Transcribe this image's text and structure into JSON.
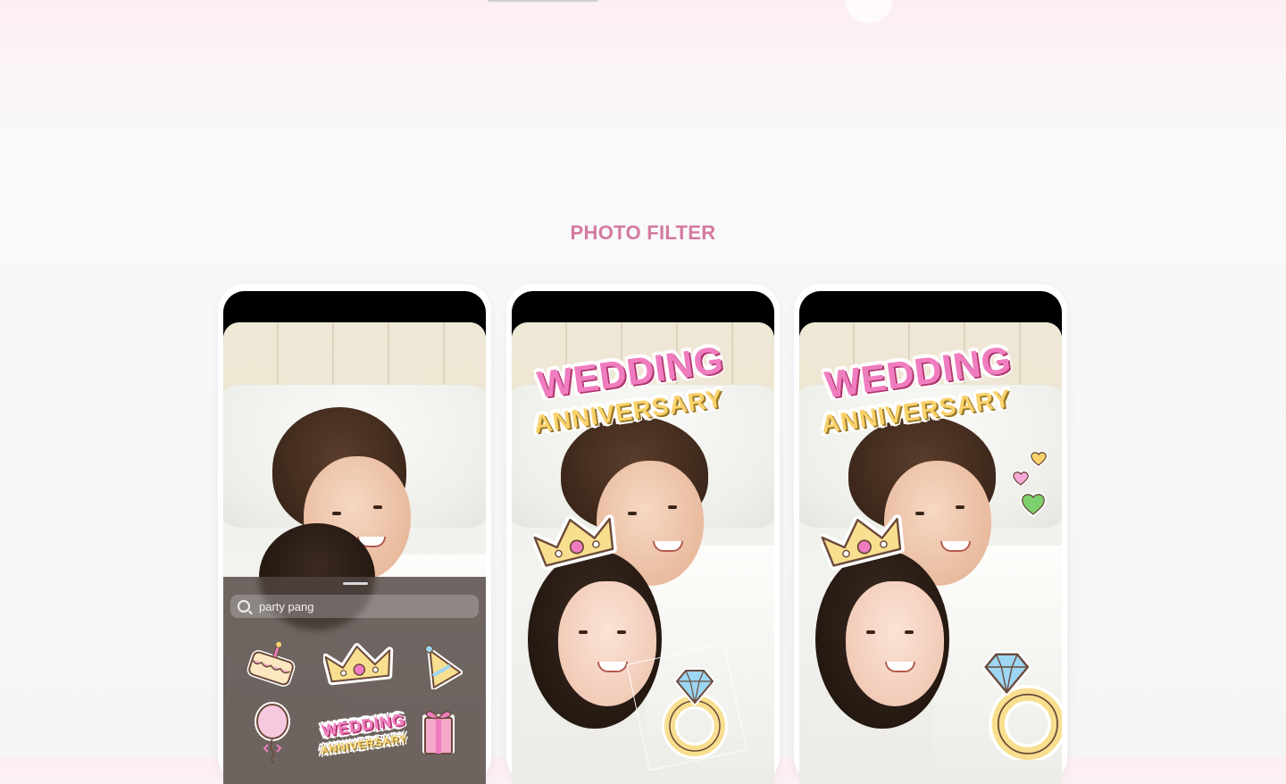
{
  "section": {
    "title": "PHOTO FILTER"
  },
  "sticker_panel": {
    "search_value": "party pang",
    "stickers": [
      "cake-sticker",
      "crown-sticker",
      "party-hat-sticker",
      "balloon-sticker",
      "wedding-anniversary-sticker",
      "gift-box-sticker"
    ]
  },
  "sticker_text": {
    "line1": "WEDDING",
    "line2": "ANNIVERSARY"
  },
  "colors": {
    "title": "#d47aa0",
    "wedding_pink": "#f07cc0",
    "anniversary_yellow": "#f9d26b",
    "heart_pink": "#f5a9d8",
    "heart_green": "#7ccf6c",
    "heart_yellow": "#f9d26b",
    "diamond_blue": "#9dd6f3"
  }
}
